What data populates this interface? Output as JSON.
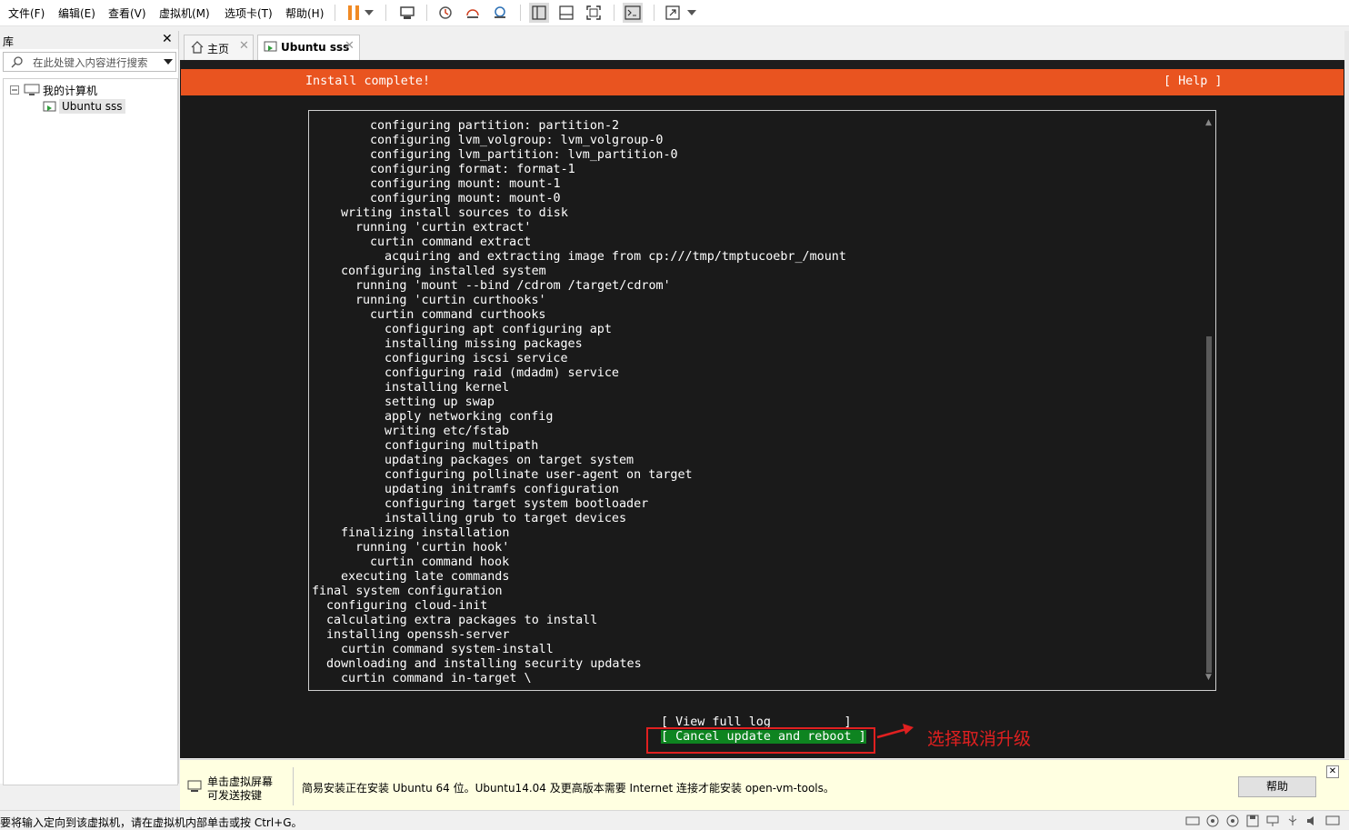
{
  "menu": {
    "file": "文件(F)",
    "edit": "编辑(E)",
    "view": "查看(V)",
    "vm": "虚拟机(M)",
    "tabs": "选项卡(T)",
    "help": "帮助(H)"
  },
  "library": {
    "title": "库",
    "search_placeholder": "在此处键入内容进行搜索",
    "tree_root": "我的计算机",
    "tree_child": "Ubuntu sss"
  },
  "tabs": [
    {
      "label": "主页"
    },
    {
      "label": "Ubuntu sss"
    }
  ],
  "installer": {
    "title": "Install complete!",
    "help": "[ Help ]",
    "log_lines": [
      {
        "indent": 4,
        "text": "configuring partition: partition-2"
      },
      {
        "indent": 4,
        "text": "configuring lvm_volgroup: lvm_volgroup-0"
      },
      {
        "indent": 4,
        "text": "configuring lvm_partition: lvm_partition-0"
      },
      {
        "indent": 4,
        "text": "configuring format: format-1"
      },
      {
        "indent": 4,
        "text": "configuring mount: mount-1"
      },
      {
        "indent": 4,
        "text": "configuring mount: mount-0"
      },
      {
        "indent": 2,
        "text": "writing install sources to disk"
      },
      {
        "indent": 3,
        "text": "running 'curtin extract'"
      },
      {
        "indent": 4,
        "text": "curtin command extract"
      },
      {
        "indent": 5,
        "text": "acquiring and extracting image from cp:///tmp/tmptucoebr_/mount"
      },
      {
        "indent": 2,
        "text": "configuring installed system"
      },
      {
        "indent": 3,
        "text": "running 'mount --bind /cdrom /target/cdrom'"
      },
      {
        "indent": 3,
        "text": "running 'curtin curthooks'"
      },
      {
        "indent": 4,
        "text": "curtin command curthooks"
      },
      {
        "indent": 5,
        "text": "configuring apt configuring apt"
      },
      {
        "indent": 5,
        "text": "installing missing packages"
      },
      {
        "indent": 5,
        "text": "configuring iscsi service"
      },
      {
        "indent": 5,
        "text": "configuring raid (mdadm) service"
      },
      {
        "indent": 5,
        "text": "installing kernel"
      },
      {
        "indent": 5,
        "text": "setting up swap"
      },
      {
        "indent": 5,
        "text": "apply networking config"
      },
      {
        "indent": 5,
        "text": "writing etc/fstab"
      },
      {
        "indent": 5,
        "text": "configuring multipath"
      },
      {
        "indent": 5,
        "text": "updating packages on target system"
      },
      {
        "indent": 5,
        "text": "configuring pollinate user-agent on target"
      },
      {
        "indent": 5,
        "text": "updating initramfs configuration"
      },
      {
        "indent": 5,
        "text": "configuring target system bootloader"
      },
      {
        "indent": 5,
        "text": "installing grub to target devices"
      },
      {
        "indent": 2,
        "text": "finalizing installation"
      },
      {
        "indent": 3,
        "text": "running 'curtin hook'"
      },
      {
        "indent": 4,
        "text": "curtin command hook"
      },
      {
        "indent": 2,
        "text": "executing late commands"
      },
      {
        "indent": 0,
        "text": "final system configuration"
      },
      {
        "indent": 1,
        "text": "configuring cloud-init"
      },
      {
        "indent": 1,
        "text": "calculating extra packages to install"
      },
      {
        "indent": 1,
        "text": "installing openssh-server"
      },
      {
        "indent": 2,
        "text": "curtin command system-install"
      },
      {
        "indent": 1,
        "text": "downloading and installing security updates"
      },
      {
        "indent": 2,
        "text": "curtin command in-target \\"
      }
    ],
    "view_log_button": "[ View full log          ]",
    "cancel_reboot_button": "[ Cancel update and reboot ]",
    "annotation": "选择取消升级"
  },
  "notification": {
    "hint_line1": "单击虚拟屏幕",
    "hint_line2": "可发送按键",
    "message": "简易安装正在安装 Ubuntu 64 位。Ubuntu14.04 及更高版本需要 Internet 连接才能安装 open-vm-tools。",
    "help_button": "帮助"
  },
  "status": {
    "text": "要将输入定向到该虚拟机，请在虚拟机内部单击或按 Ctrl+G。"
  },
  "colors": {
    "ubuntu_orange": "#e95420",
    "selected_green": "#0e8420",
    "annotation_red": "#e02020"
  }
}
